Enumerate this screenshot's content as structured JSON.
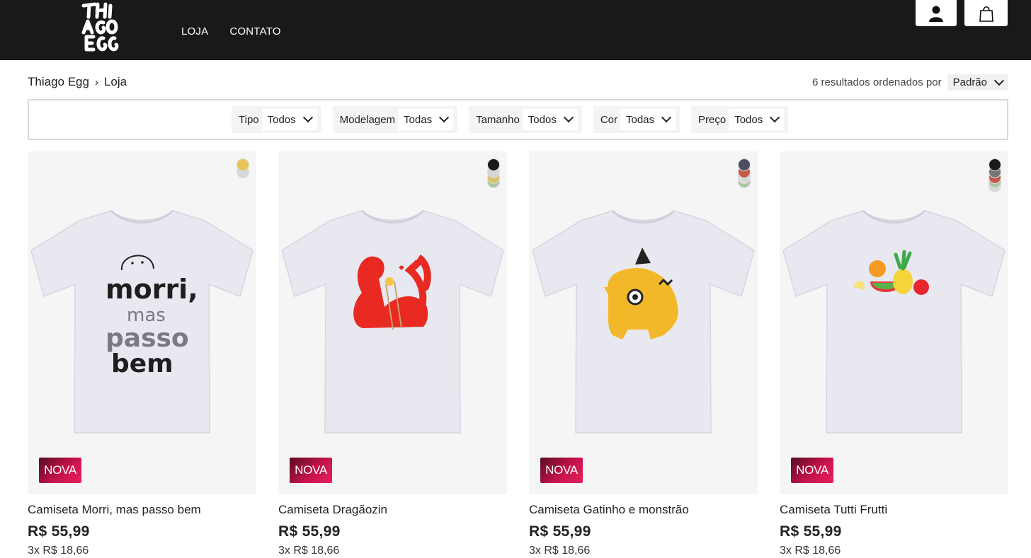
{
  "header": {
    "logo_text": "THIAGO EGG",
    "nav": [
      {
        "label": "LOJA"
      },
      {
        "label": "CONTATO"
      }
    ],
    "user_icon": "user-icon",
    "cart_icon": "shopping-bag-icon"
  },
  "breadcrumb": {
    "home": "Thiago Egg",
    "separator": "›",
    "current": "Loja"
  },
  "sort": {
    "results_text": "6 resultados ordenados por",
    "selected": "Padrão"
  },
  "filters": [
    {
      "label": "Tipo",
      "value": "Todos"
    },
    {
      "label": "Modelagem",
      "value": "Todas"
    },
    {
      "label": "Tamanho",
      "value": "Todos"
    },
    {
      "label": "Cor",
      "value": "Todas"
    },
    {
      "label": "Preço",
      "value": "Todos"
    }
  ],
  "products": [
    {
      "name": "Camiseta Morri, mas passo bem",
      "price": "R$ 55,99",
      "installments": "3x R$ 18,66",
      "badge": "NOVA",
      "art_text": [
        "morri,",
        "mas",
        "passo",
        "bem"
      ],
      "swatches": [
        "#e9c35a",
        "#d8d8d8"
      ]
    },
    {
      "name": "Camiseta Dragãozin",
      "price": "R$ 55,99",
      "installments": "3x R$ 18,66",
      "badge": "NOVA",
      "swatches": [
        "#1a1a1a",
        "#d5d5d5",
        "#d9c36a",
        "#a7c9a0"
      ]
    },
    {
      "name": "Camiseta Gatinho e monstrão",
      "price": "R$ 55,99",
      "installments": "3x R$ 18,66",
      "badge": "NOVA",
      "swatches": [
        "#4c4c62",
        "#c55a4a",
        "#d9d9d9",
        "#a7c9a0"
      ]
    },
    {
      "name": "Camiseta Tutti Frutti",
      "price": "R$ 55,99",
      "installments": "3x R$ 18,66",
      "badge": "NOVA",
      "swatches": [
        "#1a1a1a",
        "#777777",
        "#c55a4a",
        "#a7c9a0",
        "#d9d9d9"
      ]
    }
  ]
}
